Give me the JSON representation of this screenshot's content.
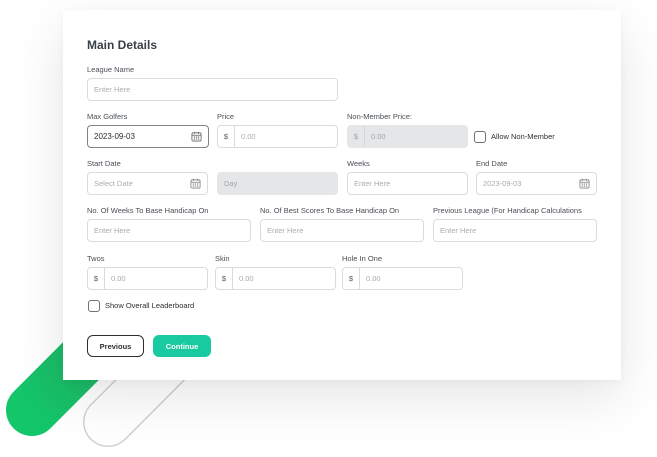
{
  "form": {
    "section_title": "Main Details",
    "league_name": {
      "label": "League Name",
      "placeholder": "Enter Here"
    },
    "max_golfers": {
      "label": "Max Golfers",
      "value": "2023-09-03"
    },
    "price": {
      "label": "Price",
      "prefix": "$",
      "placeholder": "0.00"
    },
    "non_member_price": {
      "label": "Non-Member Price:",
      "prefix": "$",
      "placeholder": "0.00"
    },
    "allow_non_member": {
      "label": "Allow Non-Member",
      "checked": false
    },
    "start_date": {
      "label": "Start Date",
      "placeholder": "Select Date"
    },
    "day": {
      "placeholder": "Day"
    },
    "weeks": {
      "label": "Weeks",
      "placeholder": "Enter Here"
    },
    "end_date": {
      "label": "End Date",
      "placeholder": "2023-09-03"
    },
    "weeks_handicap": {
      "label": "No. Of Weeks To Base Handicap On",
      "placeholder": "Enter Here"
    },
    "best_scores_handicap": {
      "label": "No. Of Best Scores To Base Handicap On",
      "placeholder": "Enter Here"
    },
    "previous_league": {
      "label": "Previous League (For Handicap Calculations",
      "placeholder": "Enter Here"
    },
    "twos": {
      "label": "Twos",
      "prefix": "$",
      "placeholder": "0.00"
    },
    "skin": {
      "label": "Skin",
      "prefix": "$",
      "placeholder": "0.00"
    },
    "hole_in_one": {
      "label": "Hole In One",
      "prefix": "$",
      "placeholder": "0.00"
    },
    "show_overall_leaderboard": {
      "label": "Show Overall Leaderboard",
      "checked": false
    },
    "previous_label": "Previous",
    "continue_label": "Continue"
  },
  "colors": {
    "accent": "#19c9a0",
    "decor_green": "#1fbf7a",
    "disabled_bg": "#e5e6e7"
  },
  "icons": [
    "calendar-icon"
  ]
}
